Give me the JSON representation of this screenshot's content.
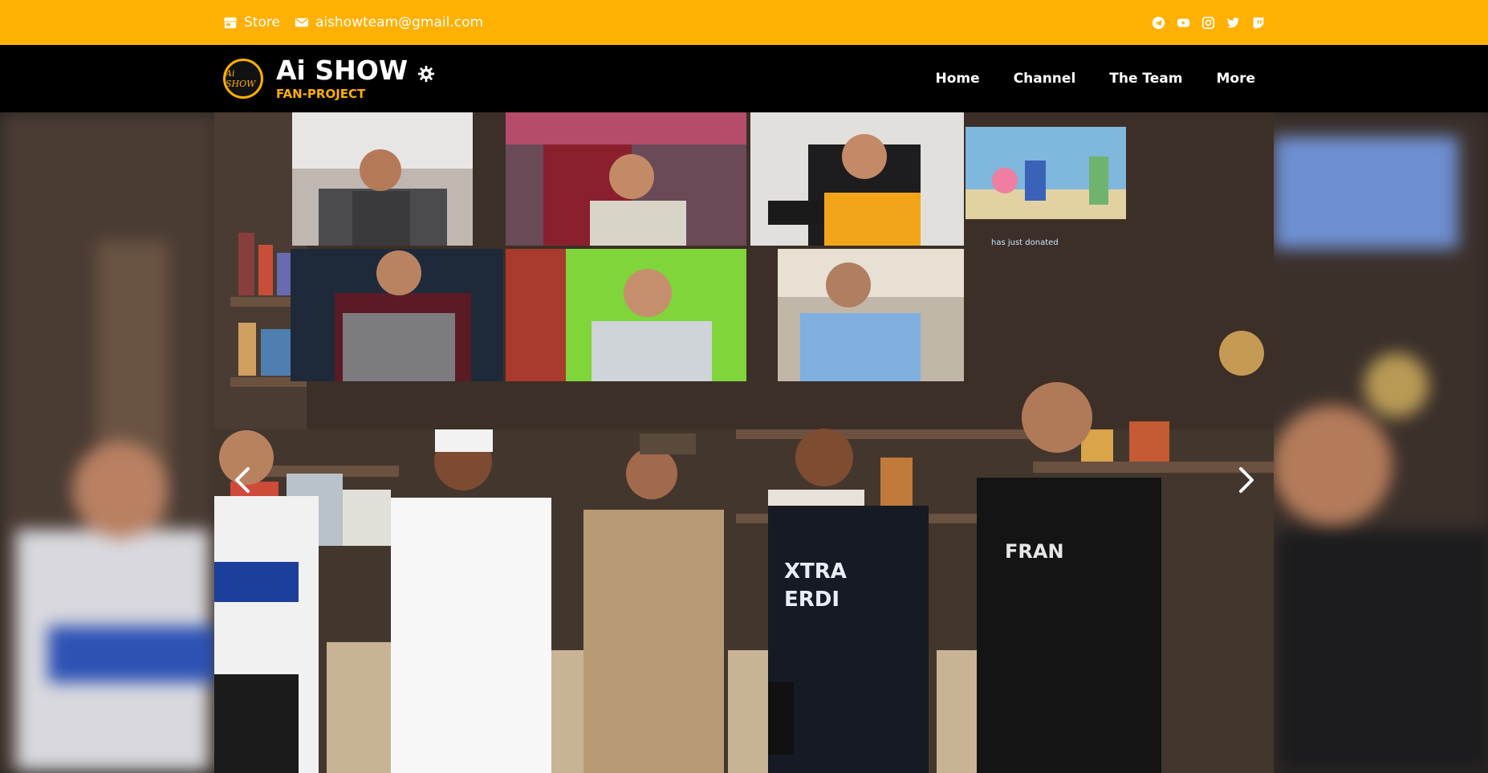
{
  "topbar": {
    "store_label": "Store",
    "email": "aishowteam@gmail.com",
    "social_icons": [
      "telegram-icon",
      "youtube-icon",
      "instagram-icon",
      "twitter-icon",
      "twitch-icon"
    ]
  },
  "brand": {
    "logo_text": "Ai SHOW",
    "title": "Ai SHOW",
    "subtitle": "FAN-PROJECT"
  },
  "nav": {
    "items": [
      "Home",
      "Channel",
      "The Team",
      "More"
    ]
  },
  "carousel": {
    "overlay_text": "has just donated"
  },
  "colors": {
    "accent": "#ffb000",
    "navbar": "#000000",
    "text": "#ffffff"
  }
}
